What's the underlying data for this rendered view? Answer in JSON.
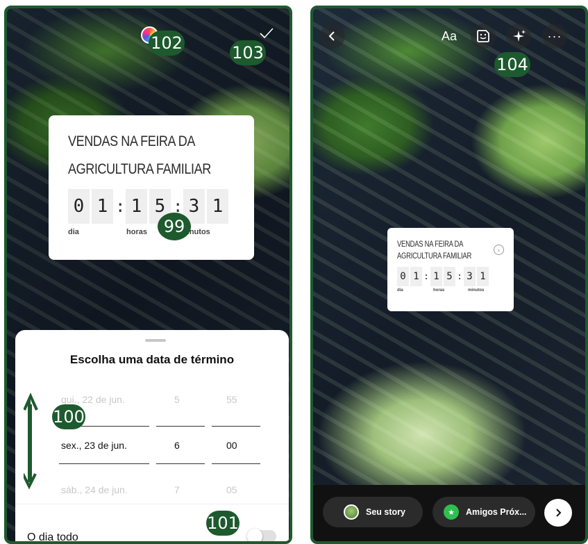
{
  "left": {
    "countdown": {
      "title_line1": "VENDAS NA FEIRA DA",
      "title_line2": "AGRICULTURA FAMILIAR",
      "digits": [
        "0",
        "1",
        "1",
        "5",
        "3",
        "1"
      ],
      "separator": ":",
      "units": {
        "days": "dia",
        "hours": "horas",
        "minutes": "minutos"
      }
    },
    "sheet": {
      "title": "Escolha uma data de término",
      "rows": [
        {
          "date": "qui., 22 de jun.",
          "hour": "5",
          "minute": "55"
        },
        {
          "date": "sex., 23 de jun.",
          "hour": "6",
          "minute": "00"
        },
        {
          "date": "sáb., 24 de jun.",
          "hour": "7",
          "minute": "05"
        }
      ],
      "all_day_label": "O dia todo",
      "all_day_on": false
    },
    "icons": {
      "color_picker": "color-wheel-icon",
      "done": "checkmark-icon"
    }
  },
  "right": {
    "countdown": {
      "title_line1": "VENDAS NA FEIRA DA",
      "title_line2": "AGRICULTURA FAMILIAR",
      "digits": [
        "0",
        "1",
        "1",
        "5",
        "3",
        "1"
      ],
      "separator": ":",
      "units": {
        "days": "dia",
        "hours": "horas",
        "minutes": "minutos"
      }
    },
    "toolbar": {
      "text_label": "Aa",
      "more_label": "···"
    },
    "share": {
      "your_story": "Seu story",
      "close_friends": "Amigos Próx..."
    }
  },
  "badges": {
    "b99": "99",
    "b100": "100",
    "b101": "101",
    "b102": "102",
    "b103": "103",
    "b104": "104"
  },
  "colors": {
    "frame": "#1d5a2e",
    "badge": "#1d5a2e",
    "close_friends_green": "#2fbf4f"
  }
}
